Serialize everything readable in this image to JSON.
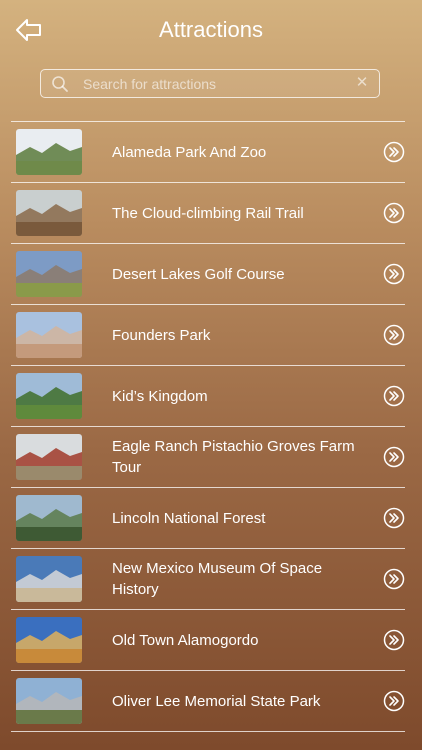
{
  "header": {
    "title": "Attractions"
  },
  "search": {
    "placeholder": "Search for attractions"
  },
  "attractions": [
    {
      "label": "Alameda Park And Zoo",
      "sky": "#e9edf1",
      "ground": "#6f8a4a",
      "accent": "#5a7a3c"
    },
    {
      "label": "The Cloud-climbing Rail Trail",
      "sky": "#c9cfcf",
      "ground": "#7a5a3c",
      "accent": "#8a6a4a"
    },
    {
      "label": "Desert Lakes Golf Course",
      "sky": "#7d9bc5",
      "ground": "#8a9a4a",
      "accent": "#8c7a6a"
    },
    {
      "label": "Founders Park",
      "sky": "#a9c1df",
      "ground": "#c49a7c",
      "accent": "#d2b49c"
    },
    {
      "label": "Kid’s Kingdom",
      "sky": "#9fbbd7",
      "ground": "#5f8a3c",
      "accent": "#3f6e2a"
    },
    {
      "label": "Eagle Ranch Pistachio Groves Farm Tour",
      "sky": "#d9dcde",
      "ground": "#9a8a6c",
      "accent": "#a03a2a"
    },
    {
      "label": "Lincoln National Forest",
      "sky": "#9fb9cf",
      "ground": "#3e5a34",
      "accent": "#5a7a4a"
    },
    {
      "label": "New Mexico Museum Of Space History",
      "sky": "#4a7ab8",
      "ground": "#c9b99a",
      "accent": "#d8d8d8"
    },
    {
      "label": "Old Town Alamogordo",
      "sky": "#3a6fbf",
      "ground": "#c88a3a",
      "accent": "#e0b25a"
    },
    {
      "label": "Oliver Lee Memorial State Park",
      "sky": "#8fb1d4",
      "ground": "#6a7a4a",
      "accent": "#b7b7b7"
    }
  ]
}
